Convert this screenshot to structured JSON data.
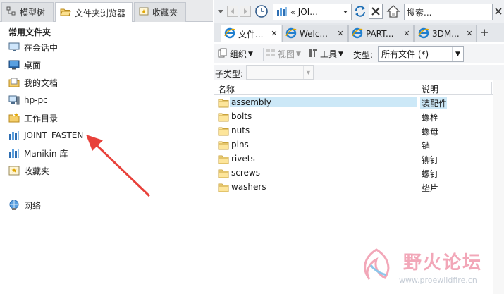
{
  "left_panel": {
    "tabs": [
      {
        "label": "模型树",
        "icon": "model-tree-icon"
      },
      {
        "label": "文件夹浏览器",
        "icon": "folder-browser-icon"
      },
      {
        "label": "收藏夹",
        "icon": "favorites-icon"
      }
    ],
    "section_title": "常用文件夹",
    "items": [
      {
        "label": "在会话中",
        "icon": "monitor-icon"
      },
      {
        "label": "桌面",
        "icon": "desktop-icon"
      },
      {
        "label": "我的文档",
        "icon": "documents-icon"
      },
      {
        "label": "hp-pc",
        "icon": "computer-icon"
      },
      {
        "label": "工作目录",
        "icon": "working-directory-icon"
      },
      {
        "label": "JOINT_FASTEN",
        "icon": "library-icon"
      },
      {
        "label": "Manikin 库",
        "icon": "library-icon"
      },
      {
        "label": "收藏夹",
        "icon": "favorites-icon"
      },
      {
        "label": "网络",
        "icon": "network-icon"
      }
    ]
  },
  "navigation": {
    "address_text": "JOI...",
    "search_placeholder": "搜索..."
  },
  "browser_tabs": [
    {
      "label": "文件...",
      "active": true
    },
    {
      "label": "Welc...",
      "active": false
    },
    {
      "label": "PART...",
      "active": false
    },
    {
      "label": "3DM...",
      "active": false
    }
  ],
  "add_tab_label": "+",
  "toolbar": {
    "organize_label": "组织",
    "view_label": "视图",
    "tools_label": "工具",
    "type_label": "类型:",
    "type_value": "所有文件 (*)"
  },
  "subtype_label": "子类型:",
  "file_list": {
    "columns": [
      "名称",
      "说明"
    ],
    "rows": [
      {
        "name": "assembly",
        "desc": "装配件",
        "selected": true
      },
      {
        "name": "bolts",
        "desc": "螺栓",
        "selected": false
      },
      {
        "name": "nuts",
        "desc": "螺母",
        "selected": false
      },
      {
        "name": "pins",
        "desc": "销",
        "selected": false
      },
      {
        "name": "rivets",
        "desc": "铆钉",
        "selected": false
      },
      {
        "name": "screws",
        "desc": "螺钉",
        "selected": false
      },
      {
        "name": "washers",
        "desc": "垫片",
        "selected": false
      }
    ]
  },
  "watermark": {
    "title": "野火论坛",
    "url": "www.proewildfire.cn"
  },
  "colors": {
    "selection": "#cce8f7",
    "annotation_arrow": "#e8413a",
    "watermark_pink": "#f2a7b8"
  }
}
